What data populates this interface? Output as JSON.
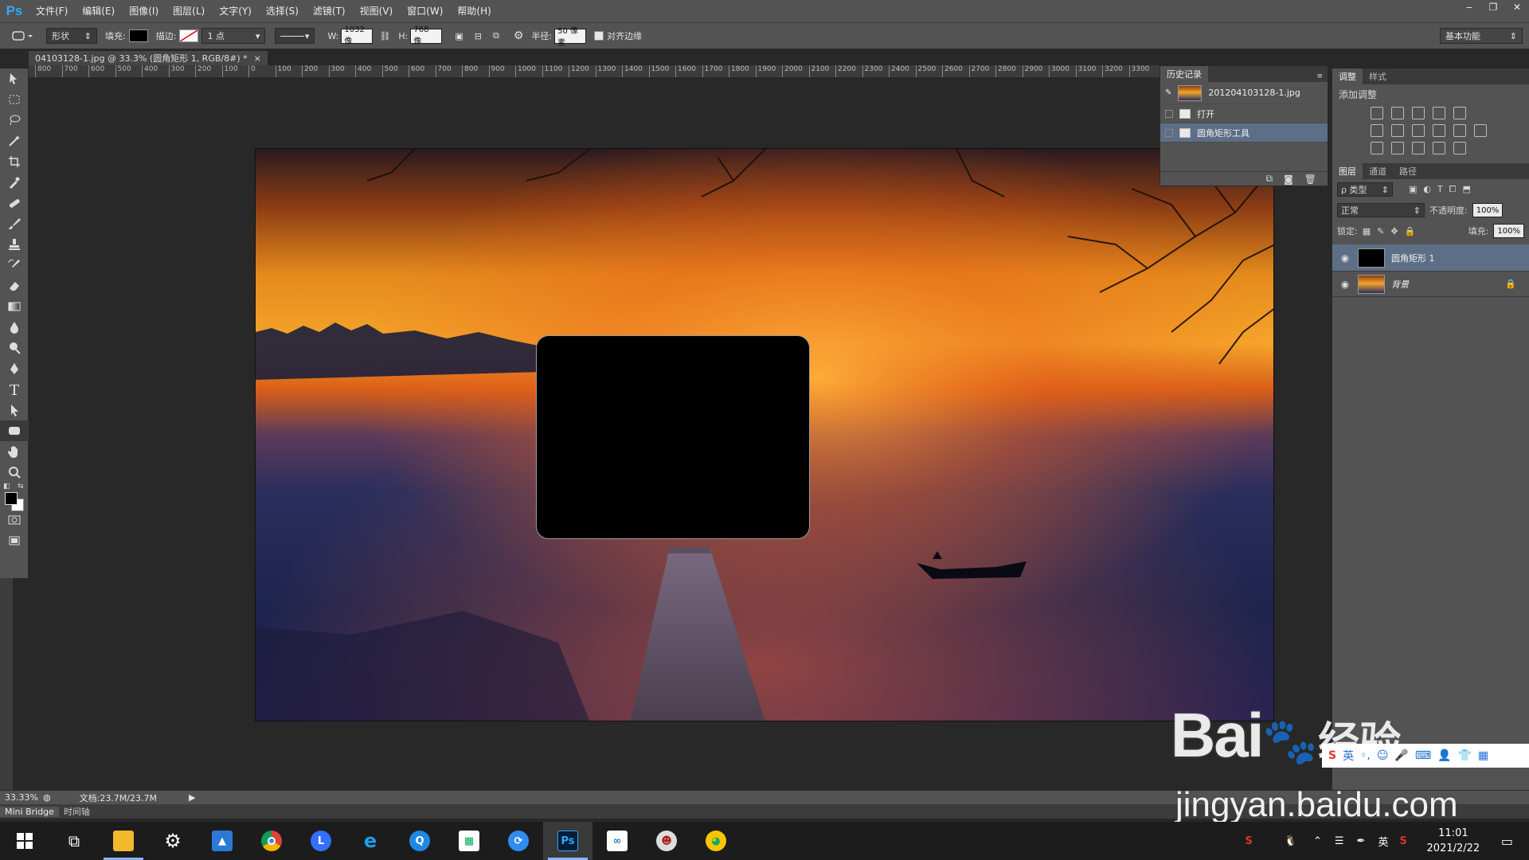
{
  "app": {
    "logo": "Ps",
    "colors": {
      "ui": "#535353",
      "dark": "#282828",
      "selection": "#5d6f86",
      "ps_blue": "#31a8ff"
    }
  },
  "menu": [
    "文件(F)",
    "编辑(E)",
    "图像(I)",
    "图层(L)",
    "文字(Y)",
    "选择(S)",
    "滤镜(T)",
    "视图(V)",
    "窗口(W)",
    "帮助(H)"
  ],
  "window_controls": {
    "minimize": "‒",
    "restore": "❐",
    "close": "✕"
  },
  "options": {
    "mode": "形状",
    "fill_label": "填充:",
    "stroke_label": "描边:",
    "stroke_width": "1 点",
    "w_label": "W:",
    "w_value": "1032 像",
    "h_label": "H:",
    "h_value": "768 像",
    "radius_label": "半径:",
    "radius_value": "50 像素",
    "align_edges": "对齐边缘",
    "workspace": "基本功能"
  },
  "document": {
    "tab_title": "04103128-1.jpg @ 33.3% (圆角矩形 1, RGB/8#) *",
    "close": "×"
  },
  "ruler_top": [
    "800",
    "700",
    "600",
    "500",
    "400",
    "300",
    "200",
    "100",
    "0",
    "100",
    "200",
    "300",
    "400",
    "500",
    "600",
    "700",
    "800",
    "900",
    "1000",
    "1100",
    "1200",
    "1300",
    "1400",
    "1500",
    "1600",
    "1700",
    "1800",
    "1900",
    "2000",
    "2100",
    "2200",
    "2300",
    "2400",
    "2500",
    "2600",
    "2700",
    "2800",
    "2900",
    "3000",
    "3100",
    "3200",
    "3300"
  ],
  "history": {
    "tabs": [
      "历史记录"
    ],
    "snapshot": "201204103128-1.jpg",
    "steps": [
      {
        "label": "打开",
        "selected": false
      },
      {
        "label": "圆角矩形工具",
        "selected": true
      }
    ]
  },
  "adjustments": {
    "tabs": [
      "调整",
      "样式"
    ],
    "title": "添加调整"
  },
  "layers": {
    "tabs": [
      "图层",
      "通道",
      "路径"
    ],
    "kind_filter": "ρ 类型",
    "blend_mode": "正常",
    "opacity_label": "不透明度:",
    "opacity": "100%",
    "lock_label": "锁定:",
    "fill_label": "填充:",
    "fill": "100%",
    "items": [
      {
        "name": "圆角矩形 1",
        "selected": true,
        "visible": true
      },
      {
        "name": "背景",
        "selected": false,
        "visible": true,
        "locked": true
      }
    ]
  },
  "status": {
    "zoom": "33.33%",
    "doc": "文档:23.7M/23.7M"
  },
  "bottom_tabs": [
    "Mini Bridge",
    "时间轴"
  ],
  "taskbar": {
    "apps": [
      "start",
      "task-view",
      "file-explorer",
      "settings",
      "photos",
      "chrome",
      "lark",
      "ie",
      "qq-browser",
      "store",
      "sogou-app",
      "photoshop",
      "baidu-netdisk",
      "game",
      "ball-app"
    ],
    "ps_label": "Ps",
    "tray": {
      "lang": "英",
      "time": "11:01",
      "date": "2021/2/22"
    }
  },
  "watermark": {
    "brand": "Bai",
    "brand2": "经验",
    "url": "jingyan.baidu.com"
  }
}
